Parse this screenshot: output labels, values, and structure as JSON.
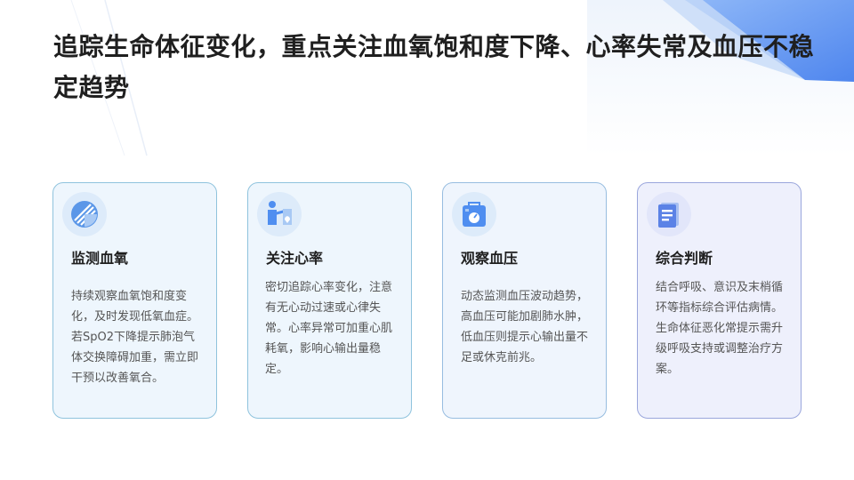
{
  "page": {
    "title": "追踪生命体征变化，重点关注血氧饱和度下降、心率失常及血压不稳定趋势"
  },
  "colors": {
    "accent": "#4f8ef0",
    "card_border": "#8fc3dd",
    "card_background": "#eef6fd",
    "title_text": "#1f1f1f",
    "body_text": "#555555"
  },
  "cards": [
    {
      "title": "监测血氧",
      "text": "持续观察血氧饱和度变化，及时发现低氧血症。若SpO2下降提示肺泡气体交换障碍加重，需立即干预以改善氧合。",
      "icon": "oxygen-gauge-icon"
    },
    {
      "title": "关注心率",
      "text": "密切追踪心率变化，注意有无心动过速或心律失常。心率异常可加重心肌耗氧，影响心输出量稳定。",
      "icon": "heart-care-icon"
    },
    {
      "title": "观察血压",
      "text": "动态监测血压波动趋势，高血压可能加剧肺水肿，低血压则提示心输出量不足或休克前兆。",
      "icon": "blood-pressure-icon"
    },
    {
      "title": "综合判断",
      "text": "结合呼吸、意识及末梢循环等指标综合评估病情。生命体征恶化常提示需升级呼吸支持或调整治疗方案。",
      "icon": "document-icon"
    }
  ]
}
